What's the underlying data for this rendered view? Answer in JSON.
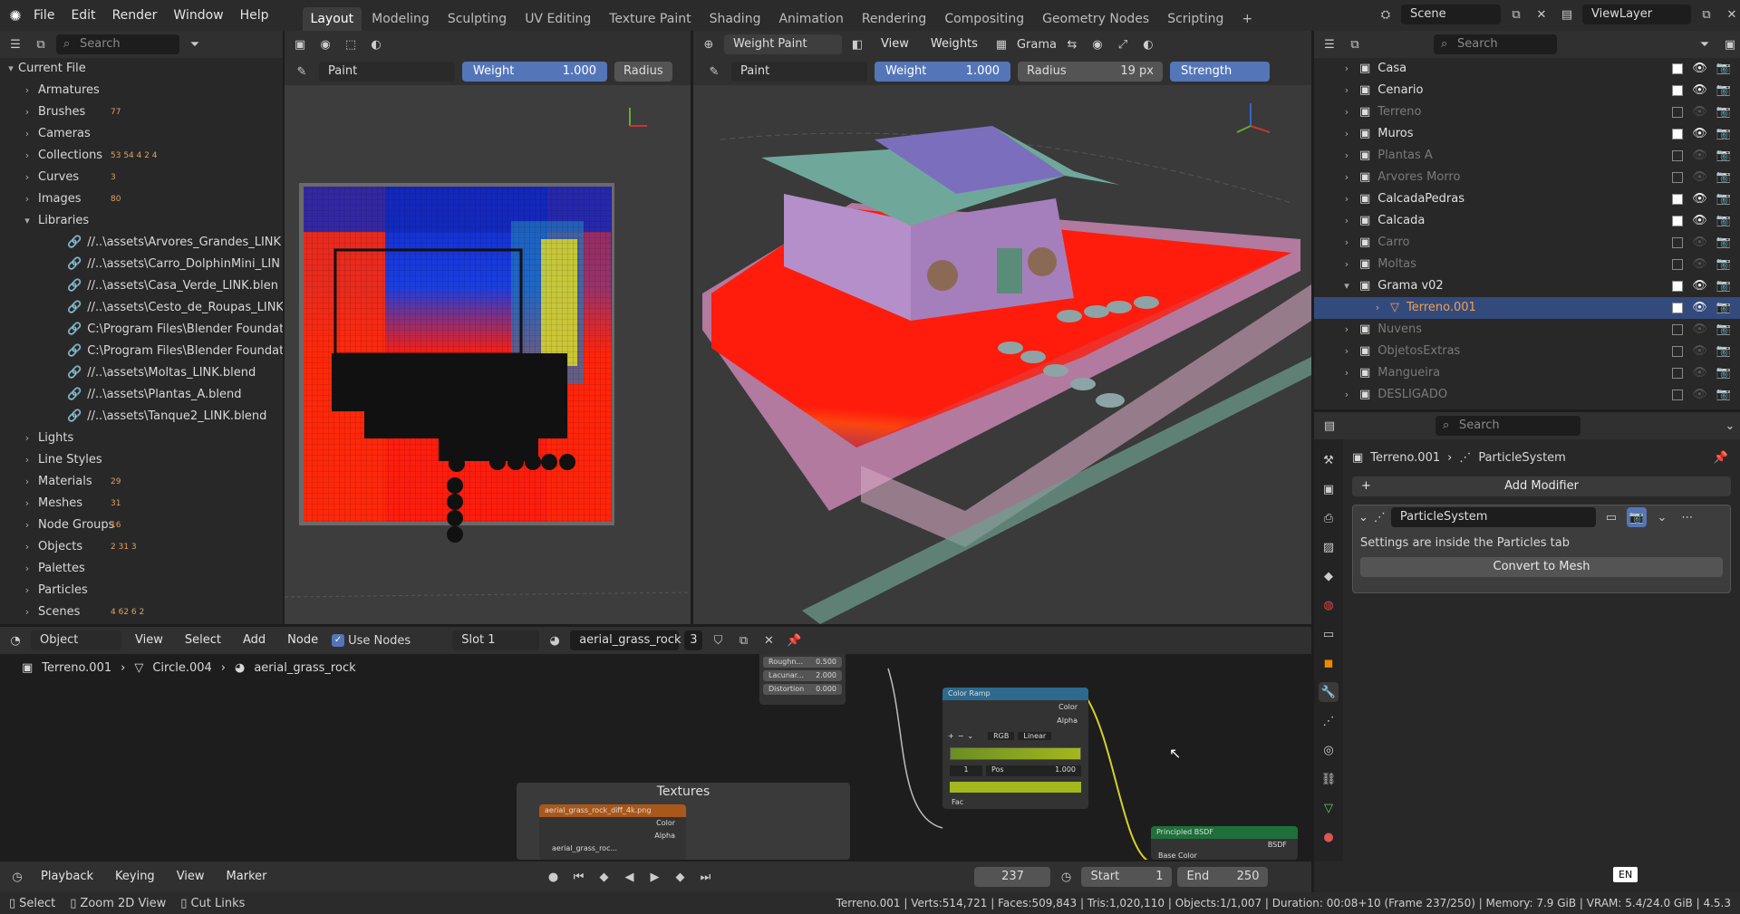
{
  "menu": [
    "File",
    "Edit",
    "Render",
    "Window",
    "Help"
  ],
  "workspaces": [
    "Layout",
    "Modeling",
    "Sculpting",
    "UV Editing",
    "Texture Paint",
    "Shading",
    "Animation",
    "Rendering",
    "Compositing",
    "Geometry Nodes",
    "Scripting"
  ],
  "active_workspace": "Layout",
  "scene_name": "Scene",
  "view_layer": "ViewLayer",
  "outliner_left": {
    "search_placeholder": "Search",
    "root": "Current File",
    "items": [
      {
        "label": "Armatures",
        "count": ""
      },
      {
        "label": "Brushes",
        "count": "77"
      },
      {
        "label": "Cameras",
        "count": ""
      },
      {
        "label": "Collections",
        "count": "53 54 4 2 4"
      },
      {
        "label": "Curves",
        "count": "3"
      },
      {
        "label": "Images",
        "count": "80"
      },
      {
        "label": "Libraries",
        "count": ""
      }
    ],
    "libraries": [
      "//..\\assets\\Arvores_Grandes_LINK",
      "//..\\assets\\Carro_DolphinMini_LIN",
      "//..\\assets\\Casa_Verde_LINK.blen",
      "//..\\assets\\Cesto_de_Roupas_LINK",
      "C:\\Program Files\\Blender Foundat",
      "C:\\Program Files\\Blender Foundat",
      "//..\\assets\\Moltas_LINK.blend",
      "//..\\assets\\Plantas_A.blend",
      "//..\\assets\\Tanque2_LINK.blend"
    ],
    "items2": [
      {
        "label": "Lights",
        "count": ""
      },
      {
        "label": "Line Styles",
        "count": ""
      },
      {
        "label": "Materials",
        "count": "29"
      },
      {
        "label": "Meshes",
        "count": "31"
      },
      {
        "label": "Node Groups",
        "count": "16"
      },
      {
        "label": "Objects",
        "count": "2 31 3"
      },
      {
        "label": "Palettes",
        "count": ""
      },
      {
        "label": "Particles",
        "count": ""
      },
      {
        "label": "Scenes",
        "count": "4 62 6 2"
      }
    ]
  },
  "uv_editor": {
    "mode": "Paint",
    "weight_label": "Weight",
    "weight_value": "1.000",
    "radius_label": "Radius"
  },
  "viewport": {
    "mode": "Weight Paint",
    "view": "View",
    "weights": "Weights",
    "brush": "Grama",
    "tool": "Paint",
    "weight_label": "Weight",
    "weight_value": "1.000",
    "radius_label": "Radius",
    "radius_value": "19 px",
    "strength_label": "Strength"
  },
  "outliner_right": {
    "search_placeholder": "Search",
    "rows": [
      {
        "label": "Casa",
        "dim": false,
        "checked": true
      },
      {
        "label": "Cenario",
        "dim": false,
        "checked": true
      },
      {
        "label": "Terreno",
        "dim": true,
        "checked": false
      },
      {
        "label": "Muros",
        "dim": false,
        "checked": true
      },
      {
        "label": "Plantas A",
        "dim": true,
        "checked": false
      },
      {
        "label": "Arvores Morro",
        "dim": true,
        "checked": false
      },
      {
        "label": "CalcadaPedras",
        "dim": false,
        "checked": true
      },
      {
        "label": "Calcada",
        "dim": false,
        "checked": true
      },
      {
        "label": "Carro",
        "dim": true,
        "checked": false
      },
      {
        "label": "Moltas",
        "dim": true,
        "checked": false
      },
      {
        "label": "Grama v02",
        "dim": false,
        "checked": true
      },
      {
        "label": "Terreno.001",
        "dim": false,
        "checked": true
      },
      {
        "label": "Nuvens",
        "dim": true,
        "checked": false
      },
      {
        "label": "ObjetosExtras",
        "dim": true,
        "checked": false
      },
      {
        "label": "Mangueira",
        "dim": true,
        "checked": false
      },
      {
        "label": "DESLIGADO",
        "dim": true,
        "checked": false
      }
    ]
  },
  "properties": {
    "search_placeholder": "Search",
    "breadcrumb_object": "Terreno.001",
    "breadcrumb_modifier": "ParticleSystem",
    "add_modifier": "Add Modifier",
    "modifier_name": "ParticleSystem",
    "info": "Settings are inside the Particles tab",
    "convert": "Convert to Mesh"
  },
  "node_editor": {
    "object_mode": "Object",
    "view": "View",
    "select": "Select",
    "add": "Add",
    "node": "Node",
    "use_nodes": "Use Nodes",
    "slot": "Slot 1",
    "material": "aerial_grass_rock",
    "users": "3",
    "crumb_object": "Terreno.001",
    "crumb_mesh": "Circle.004",
    "crumb_material": "aerial_grass_rock",
    "frame_label": "Textures",
    "image_node": "aerial_grass_rock_diff_4k.png",
    "image_color": "Color",
    "image_alpha": "Alpha",
    "image_datablock": "aerial_grass_roc...",
    "noise_rows": [
      {
        "label": "Roughn...",
        "value": "0.500"
      },
      {
        "label": "Lacunar...",
        "value": "2.000"
      },
      {
        "label": "Distortion",
        "value": "0.000"
      }
    ],
    "colorramp_title": "Color Ramp",
    "colorramp_color": "Color",
    "colorramp_alpha": "Alpha",
    "colorramp_mode": "RGB",
    "colorramp_interp": "Linear",
    "colorramp_index": "1",
    "colorramp_pos_label": "Pos",
    "colorramp_pos": "1.000",
    "colorramp_fac": "Fac",
    "bsdf_title": "Principled BSDF",
    "bsdf_out": "BSDF",
    "bsdf_base": "Base Color"
  },
  "timeline": {
    "playback": "Playback",
    "keying": "Keying",
    "view": "View",
    "marker": "Marker",
    "frame": "237",
    "start_label": "Start",
    "start": "1",
    "end_label": "End",
    "end": "250"
  },
  "statusbar": {
    "select": "Select",
    "zoom": "Zoom 2D View",
    "cut": "Cut Links",
    "stats": "Terreno.001 | Verts:514,721 | Faces:509,843 | Tris:1,020,110 | Objects:1/1,007 | Duration: 00:08+10 (Frame 237/250) | Memory: 7.9 GiB | VRAM: 5.4/24.0 GiB | 4.5.3",
    "lang": "EN"
  },
  "colors": {
    "accent": "#5476b8",
    "selected_row": "#334a7d",
    "heat_red": "#ff1d0d",
    "heat_blue": "#1326c8"
  }
}
